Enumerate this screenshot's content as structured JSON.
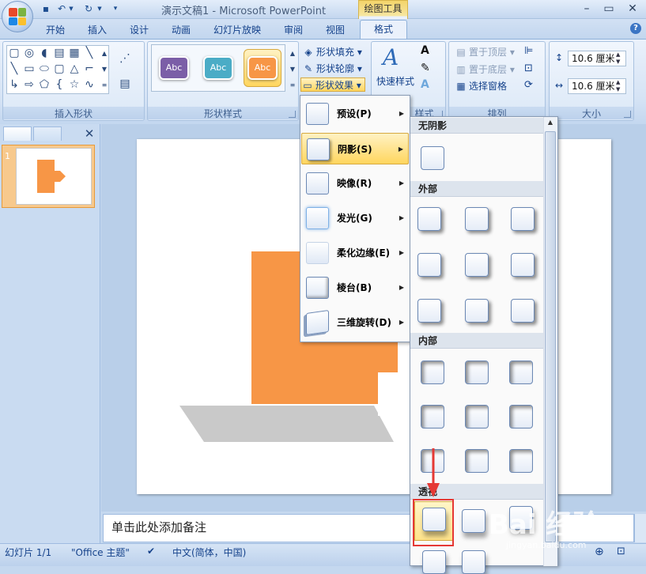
{
  "window": {
    "title": "演示文稿1 - Microsoft PowerPoint",
    "context_tab_title": "绘图工具"
  },
  "tabs": [
    "开始",
    "插入",
    "设计",
    "动画",
    "幻灯片放映",
    "审阅",
    "视图",
    "格式"
  ],
  "active_tab": "格式",
  "ribbon": {
    "groups": {
      "insert_shapes": "插入形状",
      "shape_styles": "形状样式",
      "wordart_styles": "样式",
      "arrange": "排列",
      "size": "大小"
    },
    "style_thumbs": [
      {
        "label": "Abc",
        "color": "#7b5ea7"
      },
      {
        "label": "Abc",
        "color": "#4bacc6"
      },
      {
        "label": "Abc",
        "color": "#f79646"
      }
    ],
    "shape_fill": "形状填充",
    "shape_outline": "形状轮廓",
    "shape_effects": "形状效果",
    "quick_styles": "快速样式",
    "bring_to_front": "置于顶层",
    "send_to_back": "置于底层",
    "selection_pane": "选择窗格",
    "height": "10.6 厘米",
    "width": "10.6 厘米"
  },
  "effects_menu": [
    {
      "label": "预设(P)"
    },
    {
      "label": "阴影(S)",
      "highlighted": true
    },
    {
      "label": "映像(R)"
    },
    {
      "label": "发光(G)"
    },
    {
      "label": "柔化边缘(E)"
    },
    {
      "label": "棱台(B)"
    },
    {
      "label": "三维旋转(D)"
    }
  ],
  "shadow_submenu": {
    "no_shadow": "无阴影",
    "outer": "外部",
    "inner": "内部",
    "perspective": "透视"
  },
  "left_pane": {
    "slide_number": "1"
  },
  "notes_placeholder": "单击此处添加备注",
  "status": {
    "slide": "幻灯片 1/1",
    "theme": "\"Office 主题\"",
    "language": "中文(简体，中国)"
  },
  "watermark": {
    "text": "Bai 经验",
    "url": "jingyan.baidu.com"
  },
  "colors": {
    "accent_orange": "#f79646",
    "highlight": "#ffd65e",
    "selection_red": "#e53935"
  }
}
